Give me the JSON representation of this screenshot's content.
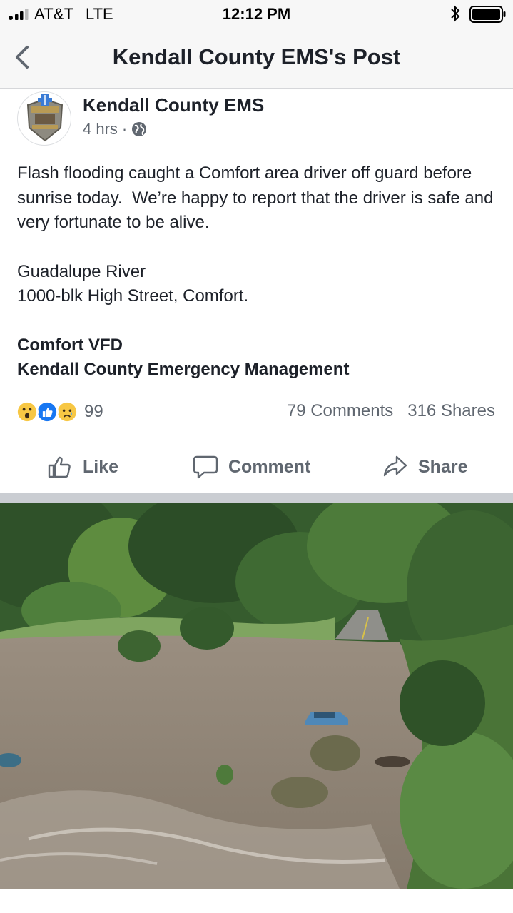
{
  "status_bar": {
    "carrier": "AT&T",
    "network": "LTE",
    "time": "12:12 PM",
    "signal_icon": "signal-bars-icon",
    "bluetooth_icon": "bluetooth-icon",
    "battery_icon": "battery-full-icon"
  },
  "nav": {
    "back_icon": "chevron-left-icon",
    "title": "Kendall County EMS's Post"
  },
  "post": {
    "author": "Kendall County EMS",
    "time_ago": "4 hrs",
    "separator": "·",
    "privacy_icon": "globe-icon",
    "avatar_icon": "paramedic-badge-icon",
    "paragraph1": "Flash flooding caught a Comfort area driver off guard before sunrise today.  We’re happy to report that the driver is safe and very fortunate to be alive.",
    "location_line1": "Guadalupe River",
    "location_line2": "1000-blk High Street, Comfort.",
    "tag_line1": "Comfort VFD",
    "tag_line2": "Kendall County Emergency Management"
  },
  "engagement": {
    "reaction_icons": [
      "wow-reaction-icon",
      "like-reaction-icon",
      "sad-reaction-icon"
    ],
    "reaction_count": "99",
    "comments": "79 Comments",
    "shares": "316 Shares"
  },
  "actions": {
    "like": "Like",
    "comment": "Comment",
    "share": "Share"
  },
  "colors": {
    "fb_blue": "#1877f2",
    "text_primary": "#1d2129",
    "text_secondary": "#606770",
    "bar_bg": "#f7f7f7",
    "water": "#8a7d6e",
    "foliage": "#3e6b35"
  }
}
